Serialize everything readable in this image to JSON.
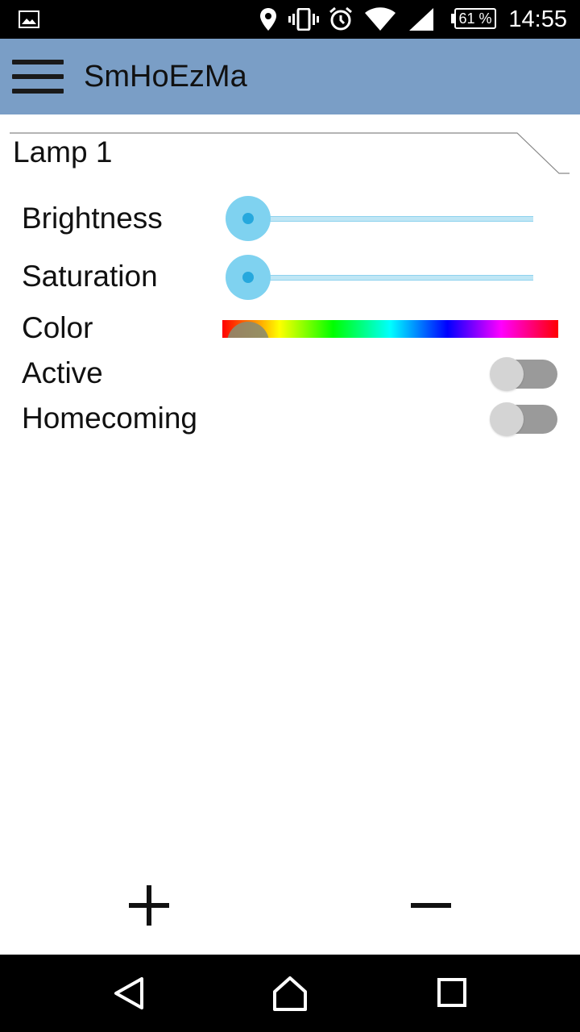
{
  "status_bar": {
    "time": "14:55",
    "battery_percent": "61 %",
    "icons": [
      "image-notification-icon",
      "location-icon",
      "vibrate-icon",
      "alarm-icon",
      "wifi-icon",
      "cell-signal-icon",
      "battery-icon"
    ]
  },
  "app_bar": {
    "title": "SmHoEzMa",
    "menu_icon": "hamburger-menu-icon"
  },
  "device": {
    "name": "Lamp 1",
    "controls": {
      "brightness": {
        "label": "Brightness",
        "value": 0
      },
      "saturation": {
        "label": "Saturation",
        "value": 0
      },
      "color": {
        "label": "Color",
        "value": 0
      },
      "active": {
        "label": "Active",
        "on": false
      },
      "homecoming": {
        "label": "Homecoming",
        "on": false
      }
    }
  },
  "actions": {
    "add_icon": "plus-icon",
    "remove_icon": "minus-icon"
  },
  "nav_bar": {
    "icons": [
      "back-icon",
      "home-icon",
      "recents-icon"
    ]
  },
  "colors": {
    "app_bar": "#7a9ec6",
    "slider_thumb": "#7fd2f0",
    "slider_dot": "#26a8dd",
    "switch_track": "#9a9a9a",
    "switch_knob": "#d4d4d4"
  }
}
